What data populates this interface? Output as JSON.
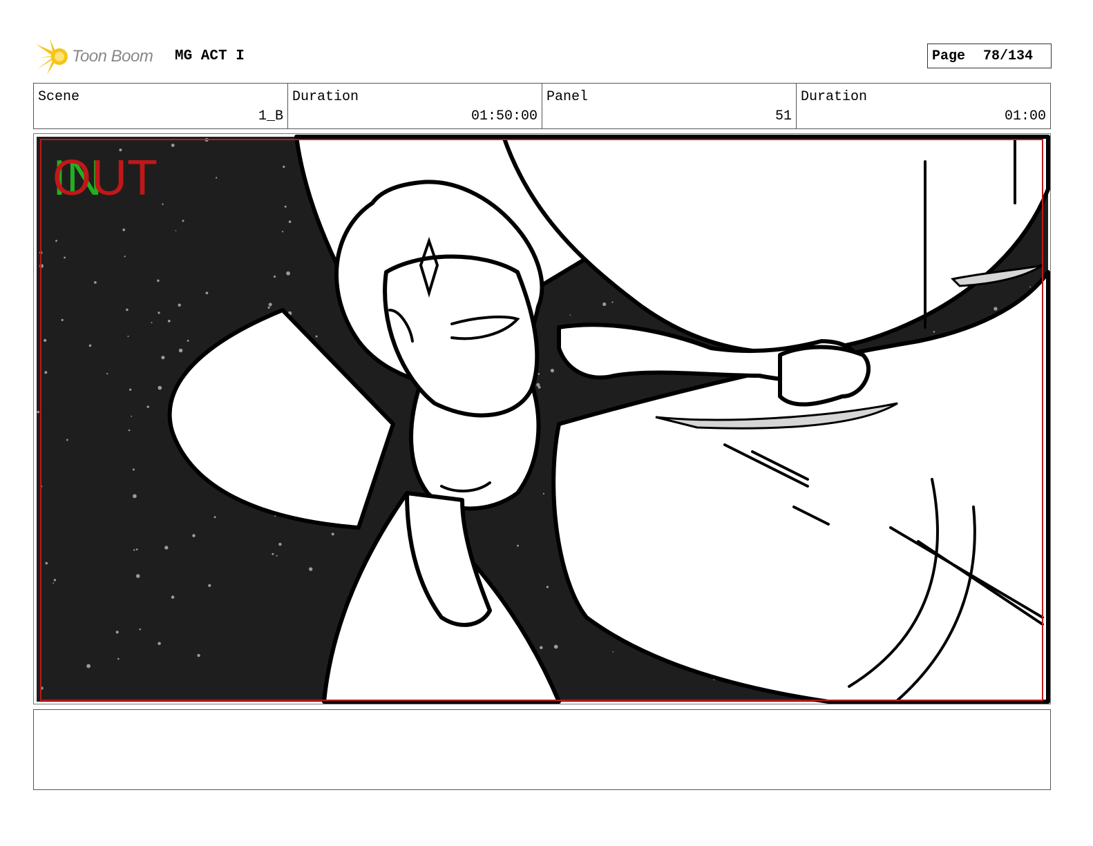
{
  "header": {
    "logo_text": "Toon Boom",
    "project_title": "MG ACT I",
    "page_label": "Page",
    "page_number": "78/134"
  },
  "info": {
    "scene_label": "Scene",
    "scene_value": "1_B",
    "duration_label": "Duration",
    "duration_value": "01:50:00",
    "panel_label": "Panel",
    "panel_value": "51",
    "panel_duration_label": "Duration",
    "panel_duration_value": "01:00"
  },
  "panel": {
    "in_marker": "IN",
    "out_marker": "OUT"
  },
  "colors": {
    "logo_yellow": "#f5c518",
    "frame_red": "#c01818",
    "in_green": "#22b022",
    "out_red": "#c01818",
    "space_dark": "#1e1e1e"
  }
}
